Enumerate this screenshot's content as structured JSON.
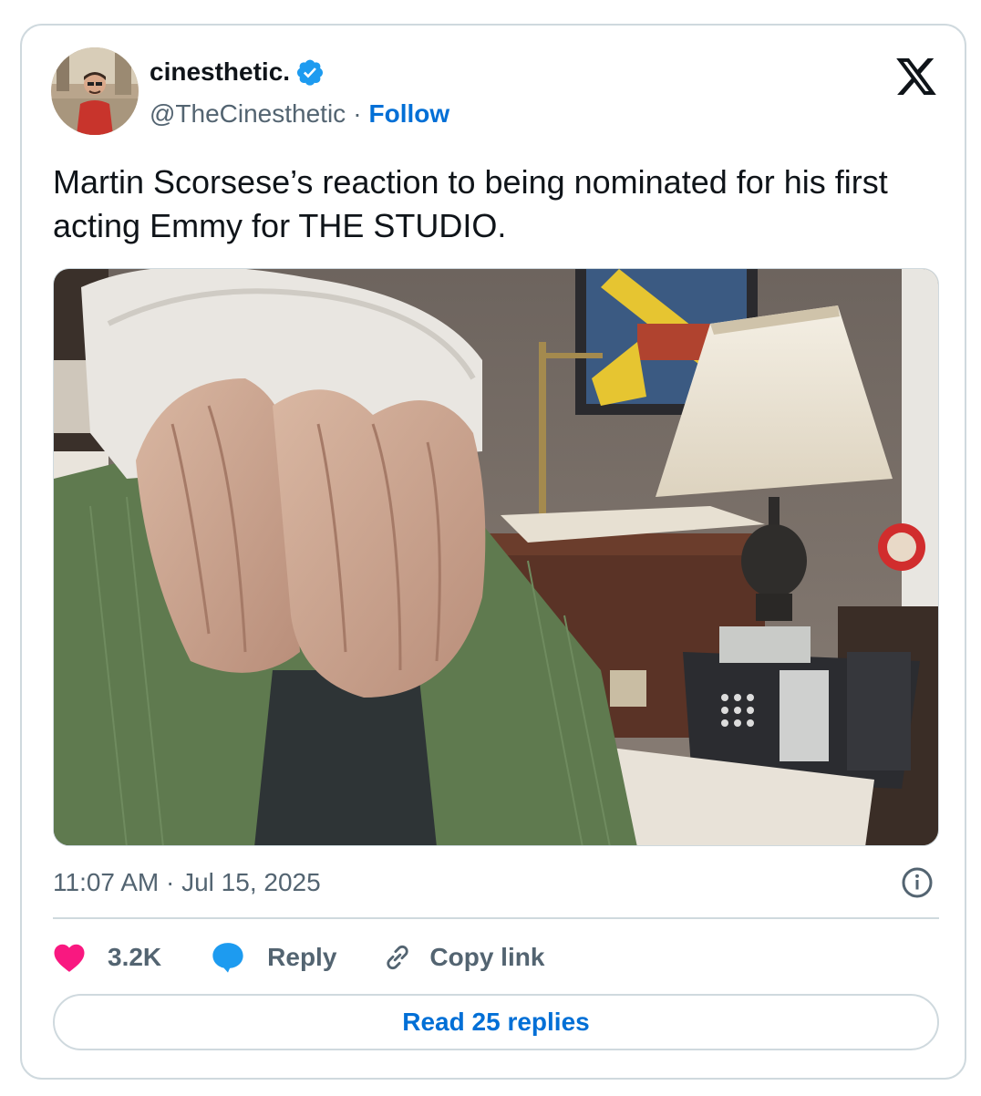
{
  "author": {
    "display_name": "cinesthetic.",
    "handle": "@TheCinesthetic",
    "separator": "·",
    "follow_label": "Follow",
    "verified": true
  },
  "tweet": {
    "text": "Martin Scorsese’s reaction to being nominated for his first acting Emmy for THE STUDIO.",
    "timestamp": "11:07 AM · Jul 15, 2025"
  },
  "actions": {
    "like_count": "3.2K",
    "reply_label": "Reply",
    "copy_link_label": "Copy link"
  },
  "footer": {
    "read_replies_label": "Read 25 replies"
  },
  "colors": {
    "accent": "#006fd6",
    "like": "#f91880",
    "reply_icon": "#1d9bf0",
    "muted": "#536471",
    "border": "#cfd9de",
    "verified": "#1d9bf0"
  },
  "icons": {
    "logo": "x-logo-icon",
    "verified": "verified-badge-icon",
    "like": "heart-icon",
    "reply": "speech-bubble-icon",
    "copy": "link-icon",
    "info": "info-icon"
  }
}
